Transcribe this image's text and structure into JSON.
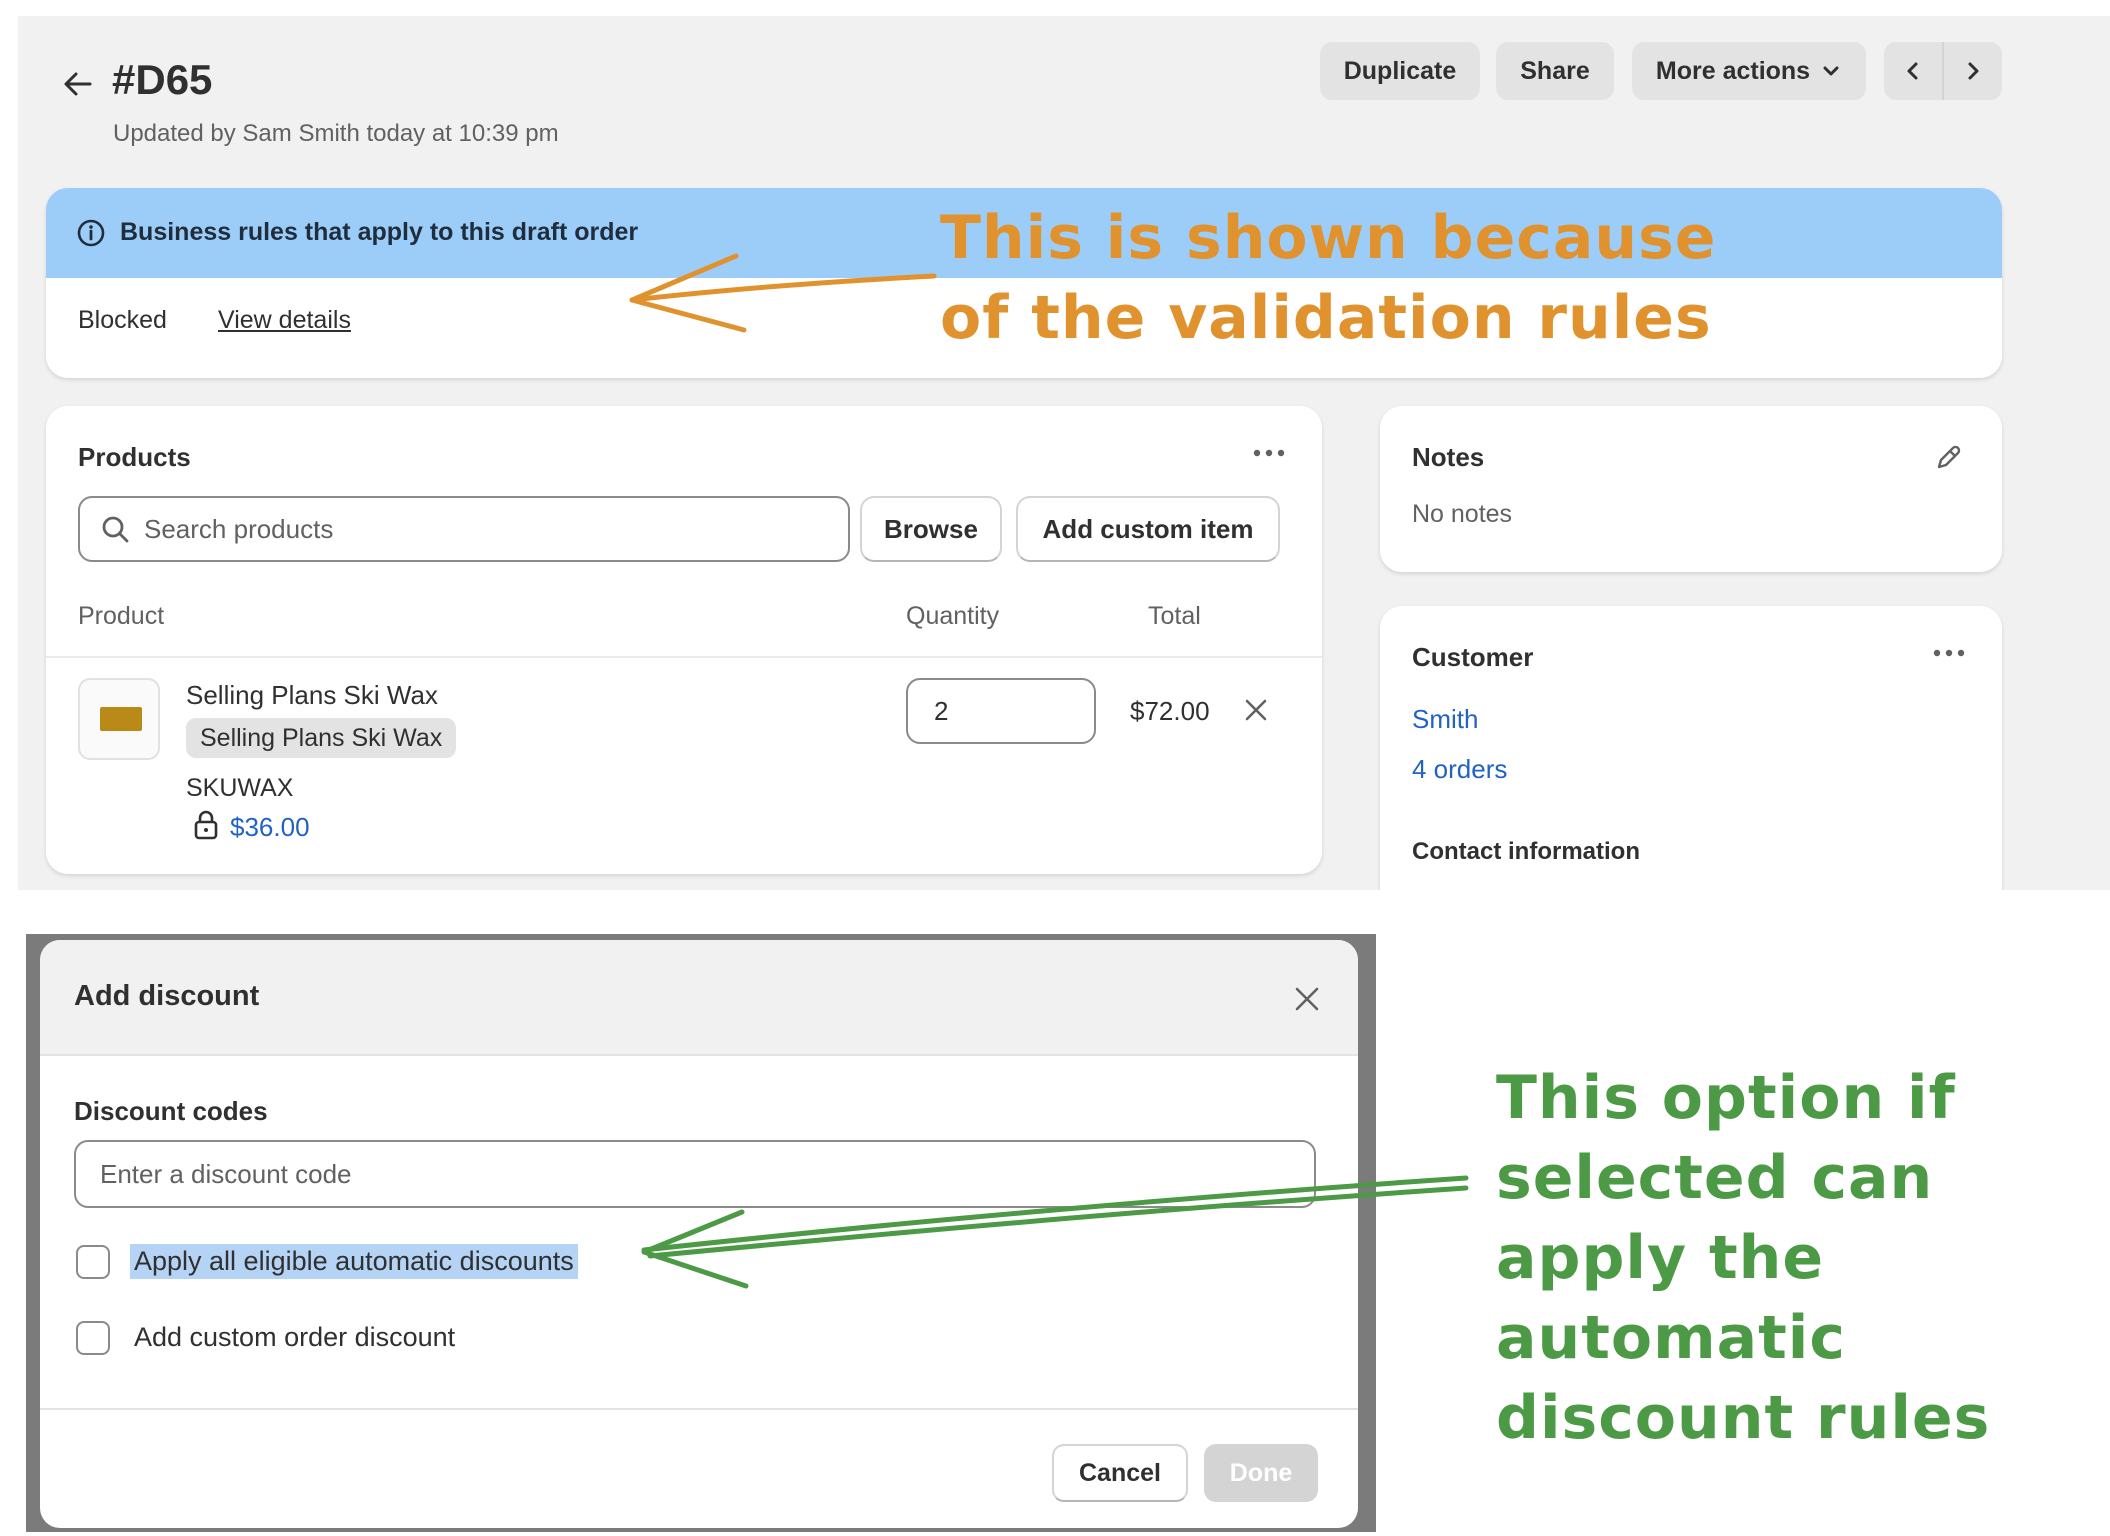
{
  "order": {
    "title": "#D65",
    "updated": "Updated by Sam Smith today at 10:39 pm"
  },
  "header_actions": {
    "duplicate": "Duplicate",
    "share": "Share",
    "more_actions": "More actions"
  },
  "business_rules": {
    "title": "Business rules that apply to this draft order",
    "status": "Blocked",
    "link": "View details"
  },
  "products": {
    "title": "Products",
    "search_placeholder": "Search products",
    "browse": "Browse",
    "add_custom": "Add custom item",
    "columns": {
      "product": "Product",
      "quantity": "Quantity",
      "total": "Total"
    },
    "item": {
      "name": "Selling Plans Ski Wax",
      "plan": "Selling Plans Ski Wax",
      "sku": "SKUWAX",
      "price": "$36.00",
      "quantity": "2",
      "total": "$72.00"
    }
  },
  "notes": {
    "title": "Notes",
    "empty": "No notes"
  },
  "customer": {
    "title": "Customer",
    "name": "Smith",
    "orders": "4 orders",
    "contact_heading": "Contact information"
  },
  "discount_modal": {
    "title": "Add discount",
    "codes_label": "Discount codes",
    "code_placeholder": "Enter a discount code",
    "option_automatic": "Apply all eligible automatic discounts",
    "option_custom": "Add custom order discount",
    "cancel": "Cancel",
    "done": "Done"
  },
  "annotations": {
    "validation": [
      "This is shown because",
      "of the validation rules"
    ],
    "automatic": [
      "This option if",
      "selected can",
      "apply the",
      "automatic",
      "discount rules"
    ]
  },
  "colors": {
    "banner": "#9ccdf8",
    "link": "#2162c4",
    "annotation_orange": "#e0922e",
    "annotation_green": "#4c9a45",
    "highlight": "#b4d3f5"
  }
}
